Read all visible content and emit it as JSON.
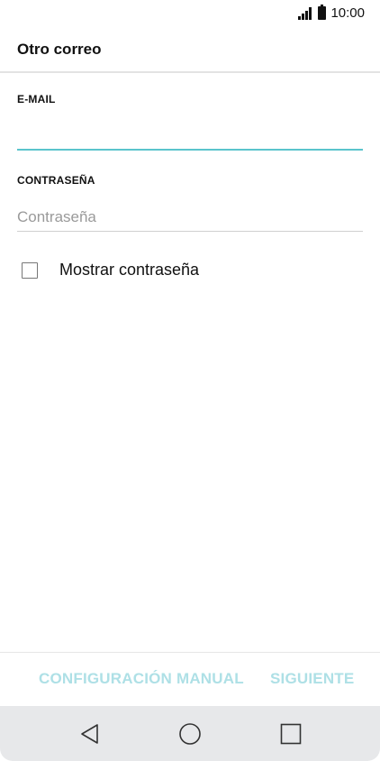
{
  "status_bar": {
    "time": "10:00",
    "signal_icon": "signal-icon",
    "battery_icon": "battery-icon"
  },
  "header": {
    "title": "Otro correo"
  },
  "form": {
    "email": {
      "label": "E-MAIL",
      "value": "",
      "placeholder": ""
    },
    "password": {
      "label": "CONTRASEÑA",
      "value": "",
      "placeholder": "Contraseña"
    },
    "show_password": {
      "label": "Mostrar contraseña",
      "checked": false
    }
  },
  "actions": {
    "manual_label": "CONFIGURACIÓN MANUAL",
    "next_label": "SIGUIENTE",
    "disabled_color": "#aee0e6"
  },
  "nav_bar": {
    "back_icon": "back-triangle-icon",
    "home_icon": "home-circle-icon",
    "recent_icon": "recent-square-icon"
  },
  "colors": {
    "accent": "#5bc4cc"
  }
}
